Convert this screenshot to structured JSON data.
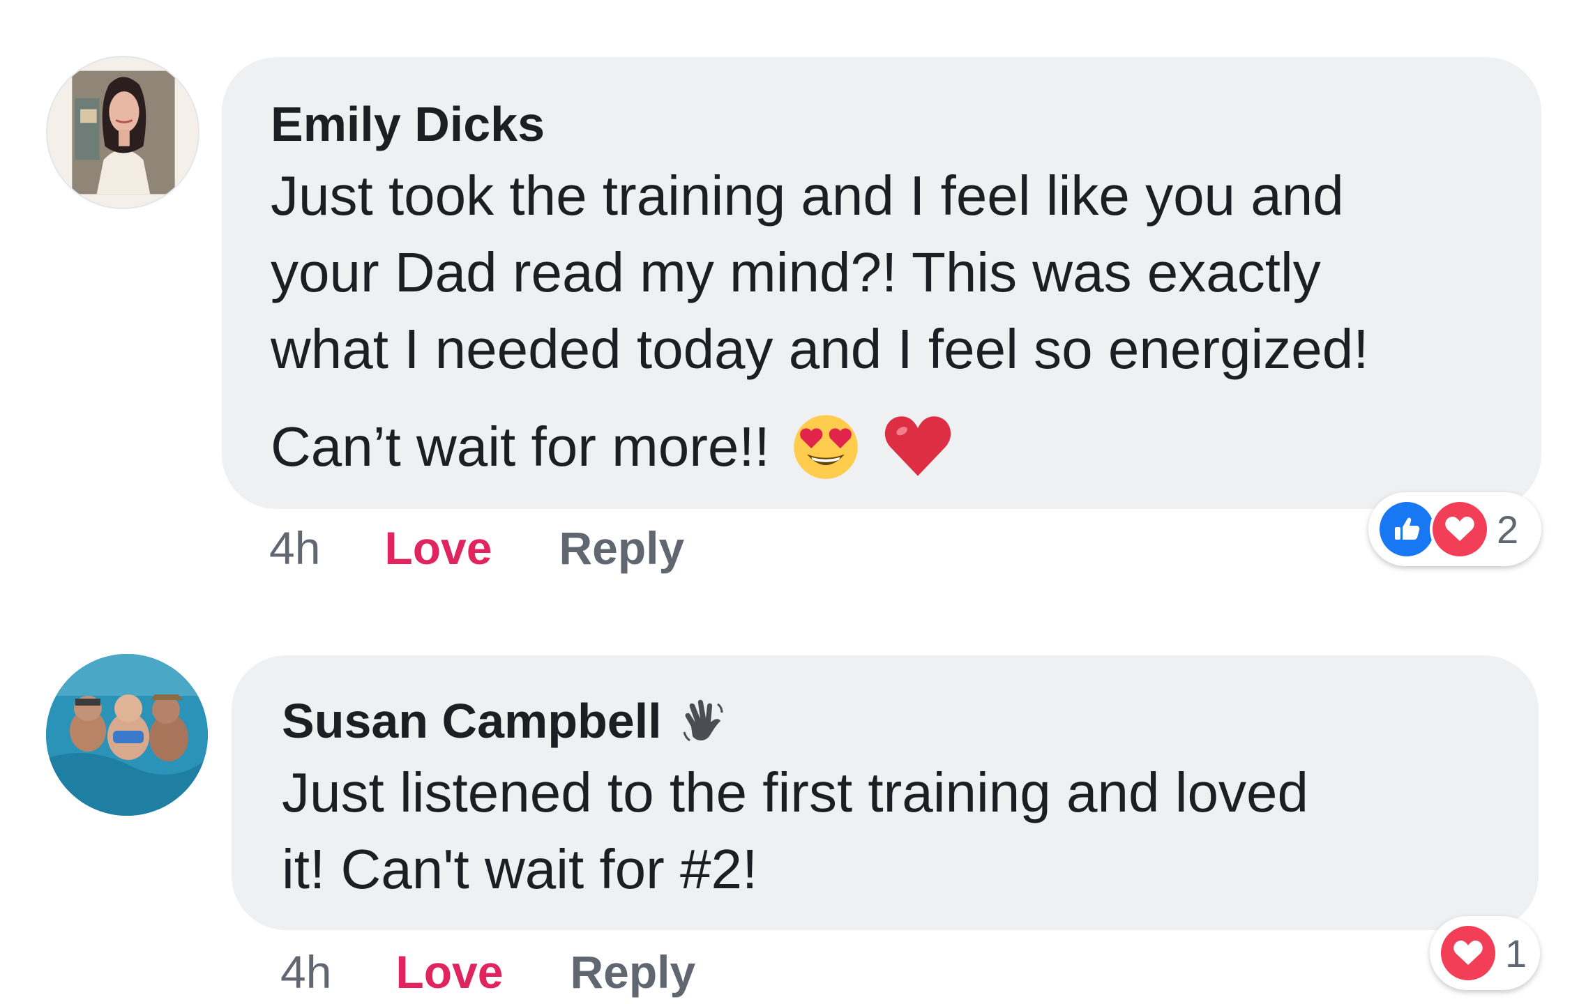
{
  "comments": [
    {
      "author": "Emily Dicks",
      "text_lines": [
        "Just took the training and I feel like you and",
        "your Dad read my mind?! This was exactly",
        "what I needed today and I feel so energized!"
      ],
      "text_last": "Can’t wait for more!!",
      "emojis": [
        "heart-eyes-emoji",
        "red-heart-emoji"
      ],
      "time": "4h",
      "love_label": "Love",
      "reply_label": "Reply",
      "reactions": {
        "icons": [
          "like-icon",
          "heart-icon"
        ],
        "count": "2"
      }
    },
    {
      "author": "Susan Campbell",
      "badge_icon": "waving-hand-icon",
      "text_lines": [
        "Just listened to the first training and loved",
        "it! Can't wait for #2!"
      ],
      "time": "4h",
      "love_label": "Love",
      "reply_label": "Reply",
      "reactions": {
        "icons": [
          "heart-icon"
        ],
        "count": "1"
      }
    }
  ],
  "colors": {
    "bubble": "#eff0f2",
    "love": "#e0245e",
    "meta": "#606770",
    "like": "#1877f2",
    "heart": "#f33e58"
  }
}
